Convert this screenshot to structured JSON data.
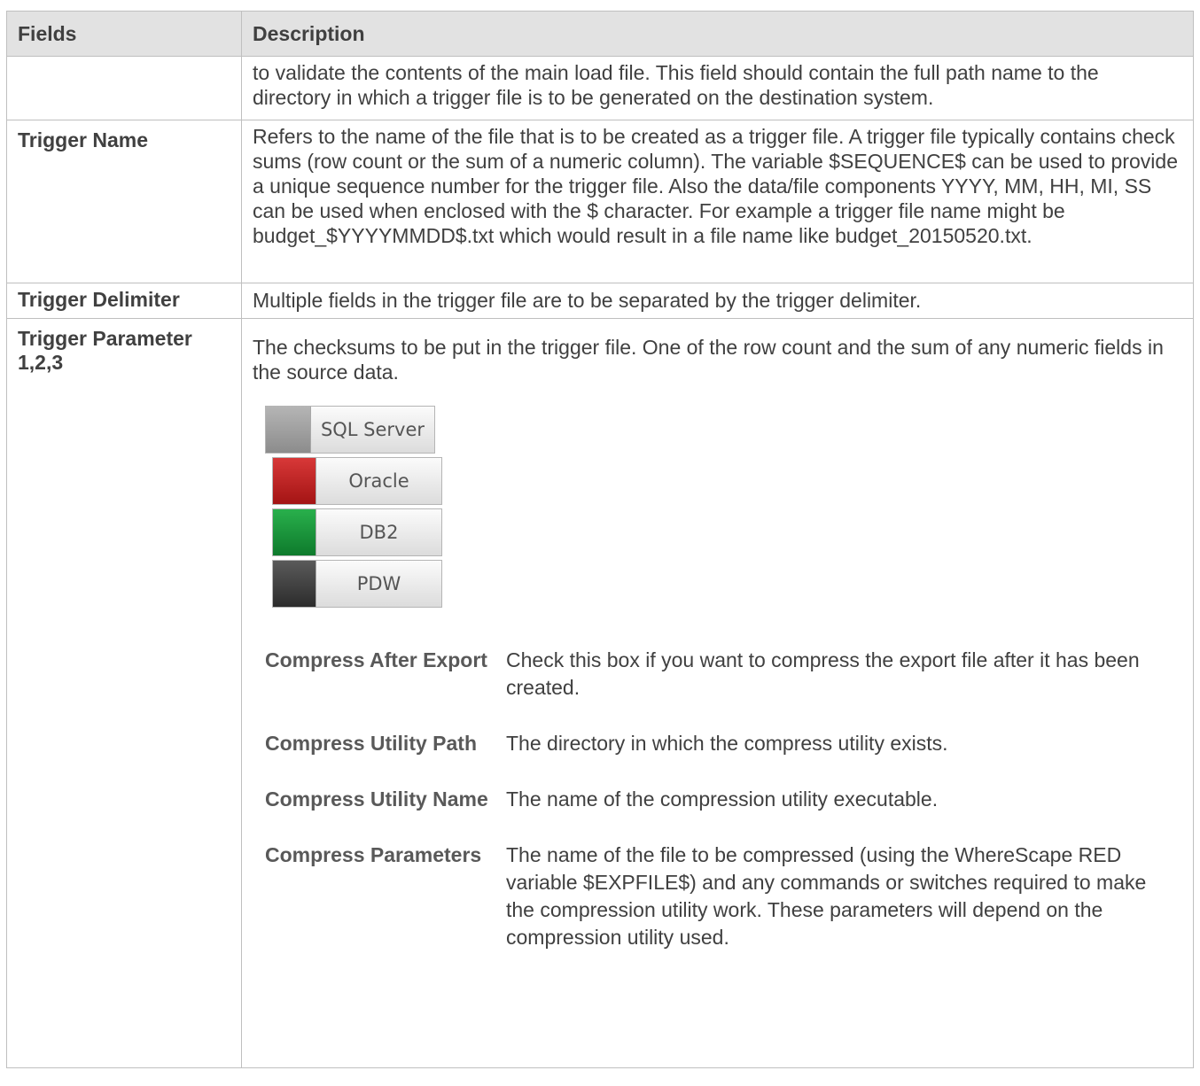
{
  "header": {
    "fields": "Fields",
    "description": "Description"
  },
  "rows": [
    {
      "field": "",
      "description": "to validate the contents of the main load file. This field should contain the full path name to the directory in which a trigger file is to be generated on the destination system."
    },
    {
      "field": "Trigger Name",
      "description": "Refers to the name of the file that is to be created as a trigger file. A trigger file typically contains check sums (row count or the sum of a numeric column). The variable $SEQUENCE$ can be used to provide a unique sequence number for the trigger file. Also the data/file components YYYY, MM, HH, MI, SS can be used when enclosed with the $ character. For example a trigger file name might be budget_$YYYYMMDD$.txt which would result in a file name like budget_20150520.txt."
    },
    {
      "field": "Trigger Delimiter",
      "description": "Multiple fields in the trigger file are to be separated by the trigger delimiter."
    },
    {
      "field": "Trigger Parameter 1,2,3",
      "description": "The checksums to be put in the trigger file. One of the row count and the sum of any numeric fields in the source data."
    }
  ],
  "db_buttons": [
    {
      "label": "SQL Server",
      "color": "#9e9e9e"
    },
    {
      "label": "Oracle",
      "color": "#c62828"
    },
    {
      "label": "DB2",
      "color": "#16963a"
    },
    {
      "label": "PDW",
      "color": "#404040"
    }
  ],
  "sub_rows": [
    {
      "field": "Compress After Export",
      "description": "Check this box if you want to compress the export file after it has been created."
    },
    {
      "field": "Compress Utility Path",
      "description": "The directory in which the compress utility exists."
    },
    {
      "field": "Compress Utility Name",
      "description": "The name of the compression utility executable."
    },
    {
      "field": "Compress Parameters",
      "description": "The name of the file to be compressed (using the WhereScape RED variable $EXPFILE$) and any commands or switches required to make the compression utility work. These parameters will depend on the compression utility used."
    }
  ]
}
